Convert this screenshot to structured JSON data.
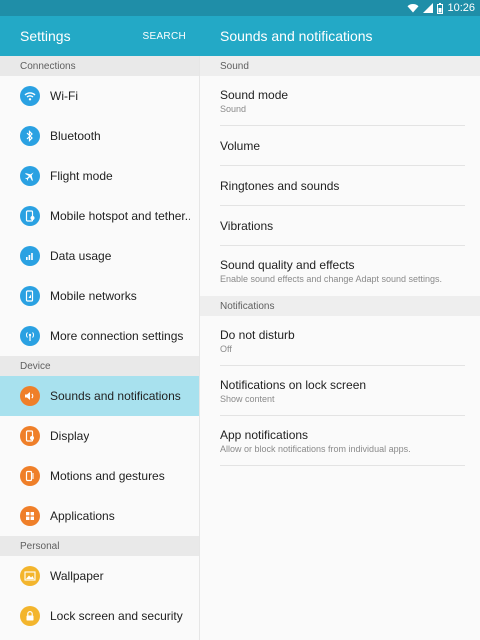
{
  "status_bar": {
    "time": "10:26",
    "icons": [
      "wifi-icon",
      "signal-icon",
      "battery-icon"
    ]
  },
  "left_header": {
    "title": "Settings",
    "search_label": "SEARCH"
  },
  "right_header": {
    "title": "Sounds and notifications"
  },
  "sidebar": {
    "sections": [
      {
        "label": "Connections",
        "items": [
          {
            "label": "Wi-Fi",
            "icon": "wifi-icon",
            "color": "#2aa1e2"
          },
          {
            "label": "Bluetooth",
            "icon": "bluetooth-icon",
            "color": "#2aa1e2"
          },
          {
            "label": "Flight mode",
            "icon": "airplane-icon",
            "color": "#2aa1e2"
          },
          {
            "label": "Mobile hotspot and tether..",
            "icon": "hotspot-icon",
            "color": "#2aa1e2"
          },
          {
            "label": "Data usage",
            "icon": "data-usage-icon",
            "color": "#2aa1e2"
          },
          {
            "label": "Mobile networks",
            "icon": "mobile-network-icon",
            "color": "#2aa1e2"
          },
          {
            "label": "More connection settings",
            "icon": "more-connections-icon",
            "color": "#2aa1e2"
          }
        ]
      },
      {
        "label": "Device",
        "items": [
          {
            "label": "Sounds and notifications",
            "icon": "speaker-icon",
            "color": "#ef7f29",
            "active": true
          },
          {
            "label": "Display",
            "icon": "display-icon",
            "color": "#ef7f29"
          },
          {
            "label": "Motions and gestures",
            "icon": "gestures-icon",
            "color": "#ef7f29"
          },
          {
            "label": "Applications",
            "icon": "applications-icon",
            "color": "#ef7f29"
          }
        ]
      },
      {
        "label": "Personal",
        "items": [
          {
            "label": "Wallpaper",
            "icon": "wallpaper-icon",
            "color": "#f3b52d"
          },
          {
            "label": "Lock screen and security",
            "icon": "lock-icon",
            "color": "#f3b52d"
          }
        ]
      }
    ]
  },
  "main": {
    "sections": [
      {
        "label": "Sound",
        "items": [
          {
            "title": "Sound mode",
            "sub": "Sound"
          },
          {
            "title": "Volume"
          },
          {
            "title": "Ringtones and sounds"
          },
          {
            "title": "Vibrations"
          },
          {
            "title": "Sound quality and effects",
            "sub": "Enable sound effects and change Adapt sound settings."
          }
        ]
      },
      {
        "label": "Notifications",
        "items": [
          {
            "title": "Do not disturb",
            "sub": "Off"
          },
          {
            "title": "Notifications on lock screen",
            "sub": "Show content"
          },
          {
            "title": "App notifications",
            "sub": "Allow or block notifications from individual apps."
          }
        ]
      }
    ]
  },
  "colors": {
    "status_bar": "#1f8ea8",
    "header": "#23a9c6",
    "active_item": "#a8e1ee"
  }
}
